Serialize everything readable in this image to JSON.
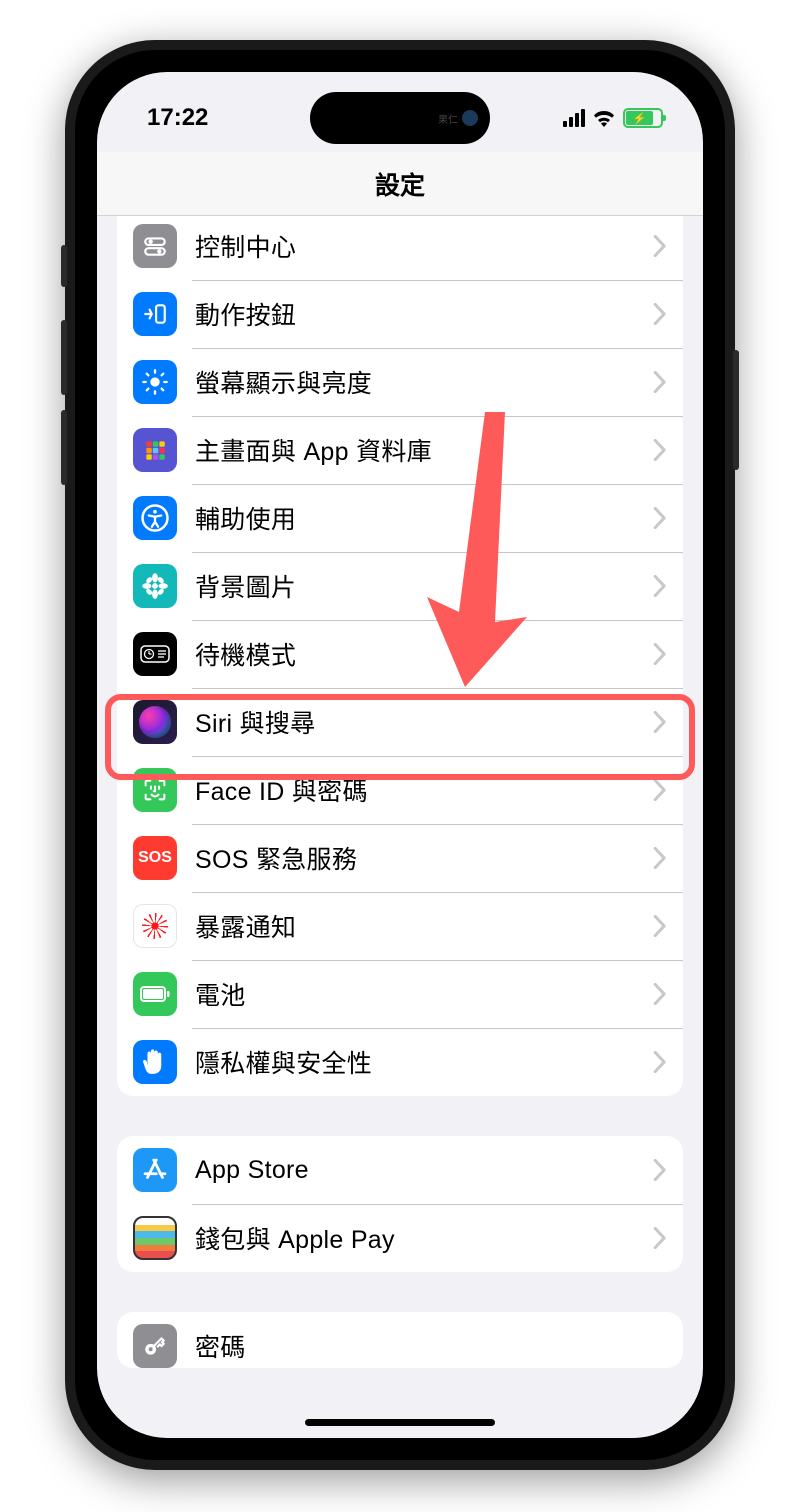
{
  "statusBar": {
    "time": "17:22",
    "islandHint": "果仁"
  },
  "header": {
    "title": "設定"
  },
  "groups": [
    {
      "items": [
        {
          "id": "control-center",
          "label": "控制中心",
          "iconClass": "ic-control",
          "iconName": "toggles-icon"
        },
        {
          "id": "action-button",
          "label": "動作按鈕",
          "iconClass": "ic-action",
          "iconName": "action-button-icon"
        },
        {
          "id": "display",
          "label": "螢幕顯示與亮度",
          "iconClass": "ic-display",
          "iconName": "brightness-icon"
        },
        {
          "id": "home-screen",
          "label": "主畫面與 App 資料庫",
          "iconClass": "ic-home",
          "iconName": "apps-grid-icon"
        },
        {
          "id": "accessibility",
          "label": "輔助使用",
          "iconClass": "ic-access",
          "iconName": "accessibility-icon"
        },
        {
          "id": "wallpaper",
          "label": "背景圖片",
          "iconClass": "ic-wallpaper",
          "iconName": "flower-icon"
        },
        {
          "id": "standby",
          "label": "待機模式",
          "iconClass": "ic-standby",
          "iconName": "clock-icon"
        },
        {
          "id": "siri",
          "label": "Siri 與搜尋",
          "iconClass": "ic-siri",
          "iconName": "siri-icon",
          "highlighted": true
        },
        {
          "id": "faceid",
          "label": "Face ID 與密碼",
          "iconClass": "ic-faceid",
          "iconName": "faceid-icon"
        },
        {
          "id": "sos",
          "label": "SOS 緊急服務",
          "iconClass": "ic-sos",
          "iconName": "sos-icon",
          "iconText": "SOS"
        },
        {
          "id": "exposure",
          "label": "暴露通知",
          "iconClass": "ic-exposure",
          "iconName": "exposure-icon"
        },
        {
          "id": "battery",
          "label": "電池",
          "iconClass": "ic-battery",
          "iconName": "battery-icon"
        },
        {
          "id": "privacy",
          "label": "隱私權與安全性",
          "iconClass": "ic-privacy",
          "iconName": "hand-icon"
        }
      ]
    },
    {
      "items": [
        {
          "id": "appstore",
          "label": "App Store",
          "iconClass": "ic-appstore",
          "iconName": "appstore-icon"
        },
        {
          "id": "wallet",
          "label": "錢包與 Apple Pay",
          "iconClass": "ic-wallet",
          "iconName": "wallet-icon"
        }
      ]
    },
    {
      "items": [
        {
          "id": "passwords",
          "label": "密碼",
          "iconClass": "ic-passwords",
          "iconName": "key-icon"
        }
      ]
    }
  ],
  "annotation": {
    "arrow_color": "#ff5a5a",
    "highlight_target": "siri"
  }
}
